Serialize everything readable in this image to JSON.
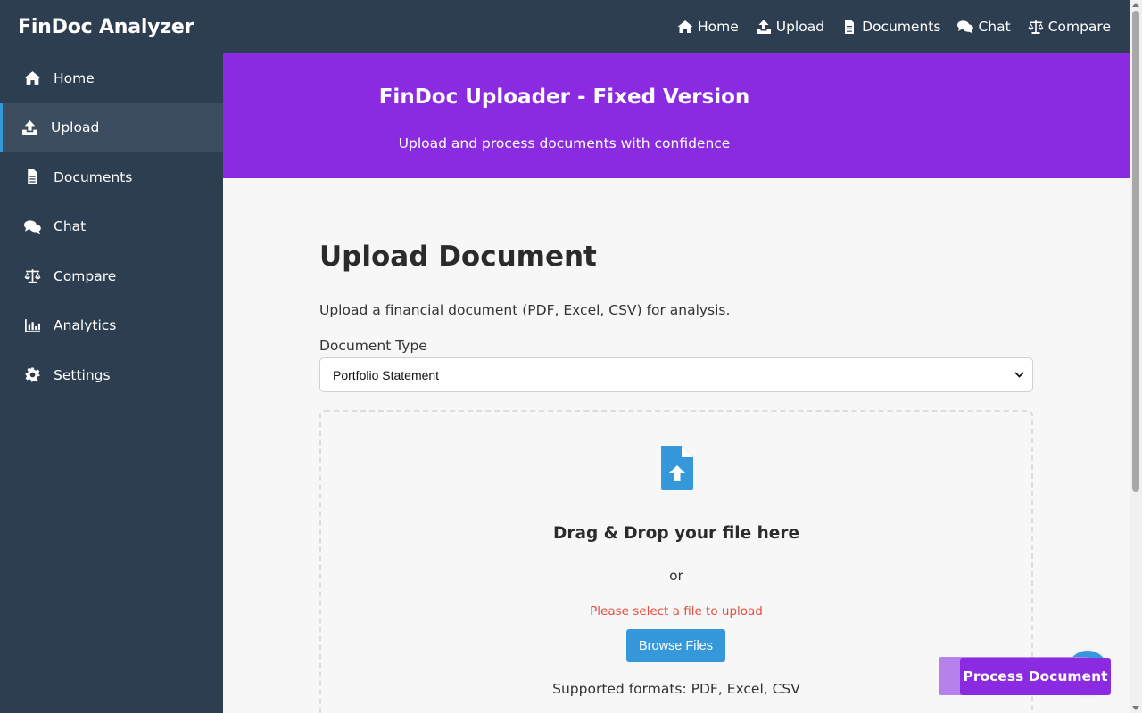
{
  "app": {
    "brand": "FinDoc Analyzer"
  },
  "topnav": [
    {
      "label": "Home",
      "icon": "home-icon"
    },
    {
      "label": "Upload",
      "icon": "upload-icon"
    },
    {
      "label": "Documents",
      "icon": "document-icon"
    },
    {
      "label": "Chat",
      "icon": "chat-icon"
    },
    {
      "label": "Compare",
      "icon": "scale-icon"
    }
  ],
  "sidebar": {
    "active": "Upload",
    "items": [
      {
        "label": "Home",
        "icon": "home-icon"
      },
      {
        "label": "Upload",
        "icon": "upload-icon"
      },
      {
        "label": "Documents",
        "icon": "document-icon"
      },
      {
        "label": "Chat",
        "icon": "chat-icon"
      },
      {
        "label": "Compare",
        "icon": "scale-icon"
      },
      {
        "label": "Analytics",
        "icon": "chart-icon"
      },
      {
        "label": "Settings",
        "icon": "gear-icon"
      }
    ]
  },
  "hero": {
    "title": "FinDoc Uploader - Fixed Version",
    "subtitle": "Upload and process documents with confidence"
  },
  "main": {
    "title": "Upload Document",
    "description": "Upload a financial document (PDF, Excel, CSV) for analysis.",
    "doc_type_label": "Document Type",
    "doc_type_selected": "Portfolio Statement"
  },
  "dropzone": {
    "icon": "file-upload-icon",
    "title": "Drag & Drop your file here",
    "or_text": "or",
    "error": "Please select a file to upload",
    "browse_label": "Browse Files",
    "formats": "Supported formats: PDF, Excel, CSV"
  },
  "actions": {
    "process_label": "Process Document"
  },
  "colors": {
    "nav_bg": "#2c3e50",
    "accent_purple": "#8a2be2",
    "accent_blue": "#3498db",
    "error_red": "#e74c3c"
  }
}
